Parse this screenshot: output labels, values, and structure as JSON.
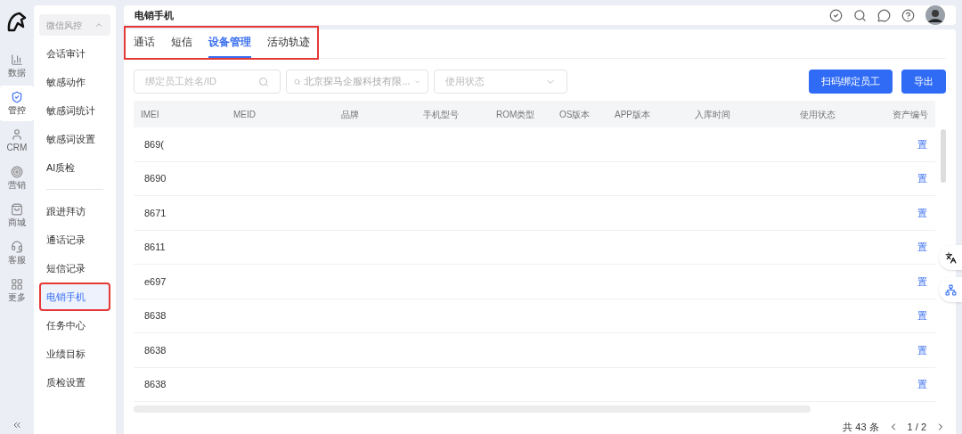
{
  "rail": [
    {
      "label": "数据",
      "selected": false
    },
    {
      "label": "管控",
      "selected": true
    },
    {
      "label": "CRM",
      "selected": false
    },
    {
      "label": "营销",
      "selected": false
    },
    {
      "label": "商城",
      "selected": false
    },
    {
      "label": "客服",
      "selected": false
    },
    {
      "label": "更多",
      "selected": false
    }
  ],
  "submenu": {
    "group": "微信风控",
    "expanded": true,
    "items": [
      {
        "label": "会话审计",
        "selected": false
      },
      {
        "label": "敏感动作",
        "selected": false
      },
      {
        "label": "敏感词统计",
        "selected": false
      },
      {
        "label": "敏感词设置",
        "selected": false
      },
      {
        "label": "AI质检",
        "selected": false
      }
    ],
    "items2": [
      {
        "label": "跟进拜访",
        "selected": false
      },
      {
        "label": "通话记录",
        "selected": false
      },
      {
        "label": "短信记录",
        "selected": false
      },
      {
        "label": "电销手机",
        "selected": true
      },
      {
        "label": "任务中心",
        "selected": false
      },
      {
        "label": "业绩目标",
        "selected": false
      },
      {
        "label": "质检设置",
        "selected": false
      }
    ]
  },
  "header": {
    "title": "电销手机"
  },
  "tabs": [
    {
      "label": "通话",
      "selected": false
    },
    {
      "label": "短信",
      "selected": false
    },
    {
      "label": "设备管理",
      "selected": true
    },
    {
      "label": "活动轨迹",
      "selected": false
    }
  ],
  "filters": {
    "search": {
      "placeholder": "绑定员工姓名/ID"
    },
    "company": {
      "value": "北京探马企服科技有限..."
    },
    "status": {
      "placeholder": "使用状态"
    }
  },
  "buttons": [
    "扫码绑定员工",
    "导出"
  ],
  "table": {
    "columns": [
      "IMEI",
      "MEID",
      "品牌",
      "手机型号",
      "ROM类型",
      "OS版本",
      "APP版本",
      "入库时间",
      "使用状态",
      "资产编号"
    ],
    "rows": [
      {
        "imei": "869(",
        "action": "置"
      },
      {
        "imei": "8690",
        "action": "置"
      },
      {
        "imei": "8671",
        "action": "置"
      },
      {
        "imei": "8611",
        "action": "置"
      },
      {
        "imei": "e697",
        "action": "置"
      },
      {
        "imei": "8638",
        "action": "置"
      },
      {
        "imei": "8638",
        "action": "置"
      },
      {
        "imei": "8638",
        "action": "置"
      }
    ]
  },
  "pagination": {
    "total": "共 43 条",
    "page": "1 / 2"
  }
}
